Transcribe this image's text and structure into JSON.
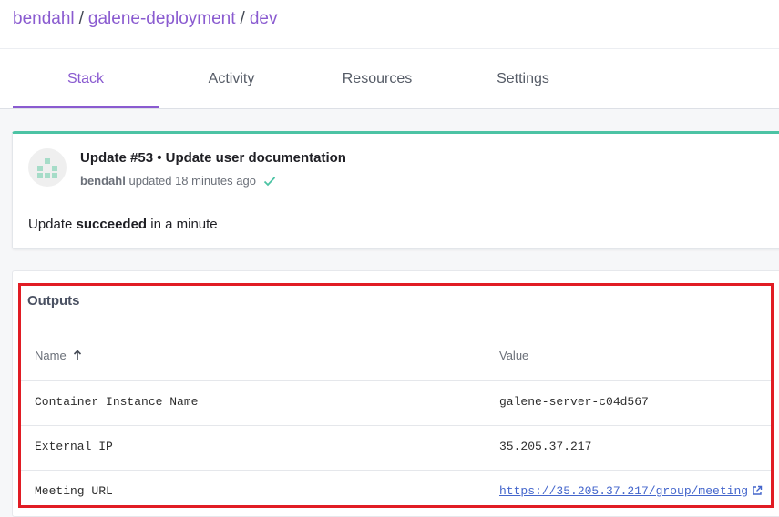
{
  "breadcrumb": {
    "org": "bendahl",
    "project": "galene-deployment",
    "stack": "dev",
    "separator": "/"
  },
  "tabs": [
    {
      "label": "Stack",
      "active": true
    },
    {
      "label": "Activity",
      "active": false
    },
    {
      "label": "Resources",
      "active": false
    },
    {
      "label": "Settings",
      "active": false
    }
  ],
  "update": {
    "title": "Update #53 • Update user documentation",
    "user": "bendahl",
    "meta_text": "updated 18 minutes ago",
    "result_prefix": "Update",
    "result_status": "succeeded",
    "result_suffix": "in a minute",
    "status_color": "#4cc3a4"
  },
  "outputs": {
    "title": "Outputs",
    "columns": {
      "name": "Name",
      "value": "Value"
    },
    "rows": [
      {
        "name": "Container Instance Name",
        "value": "galene-server-c04d567"
      },
      {
        "name": "External IP",
        "value": "35.205.37.217"
      },
      {
        "name": "Meeting URL",
        "value": "https://35.205.37.217/group/meeting",
        "is_link": true
      }
    ]
  },
  "colors": {
    "accent": "#8a5bd0",
    "highlight": "#e11c24",
    "link": "#4466cc"
  }
}
